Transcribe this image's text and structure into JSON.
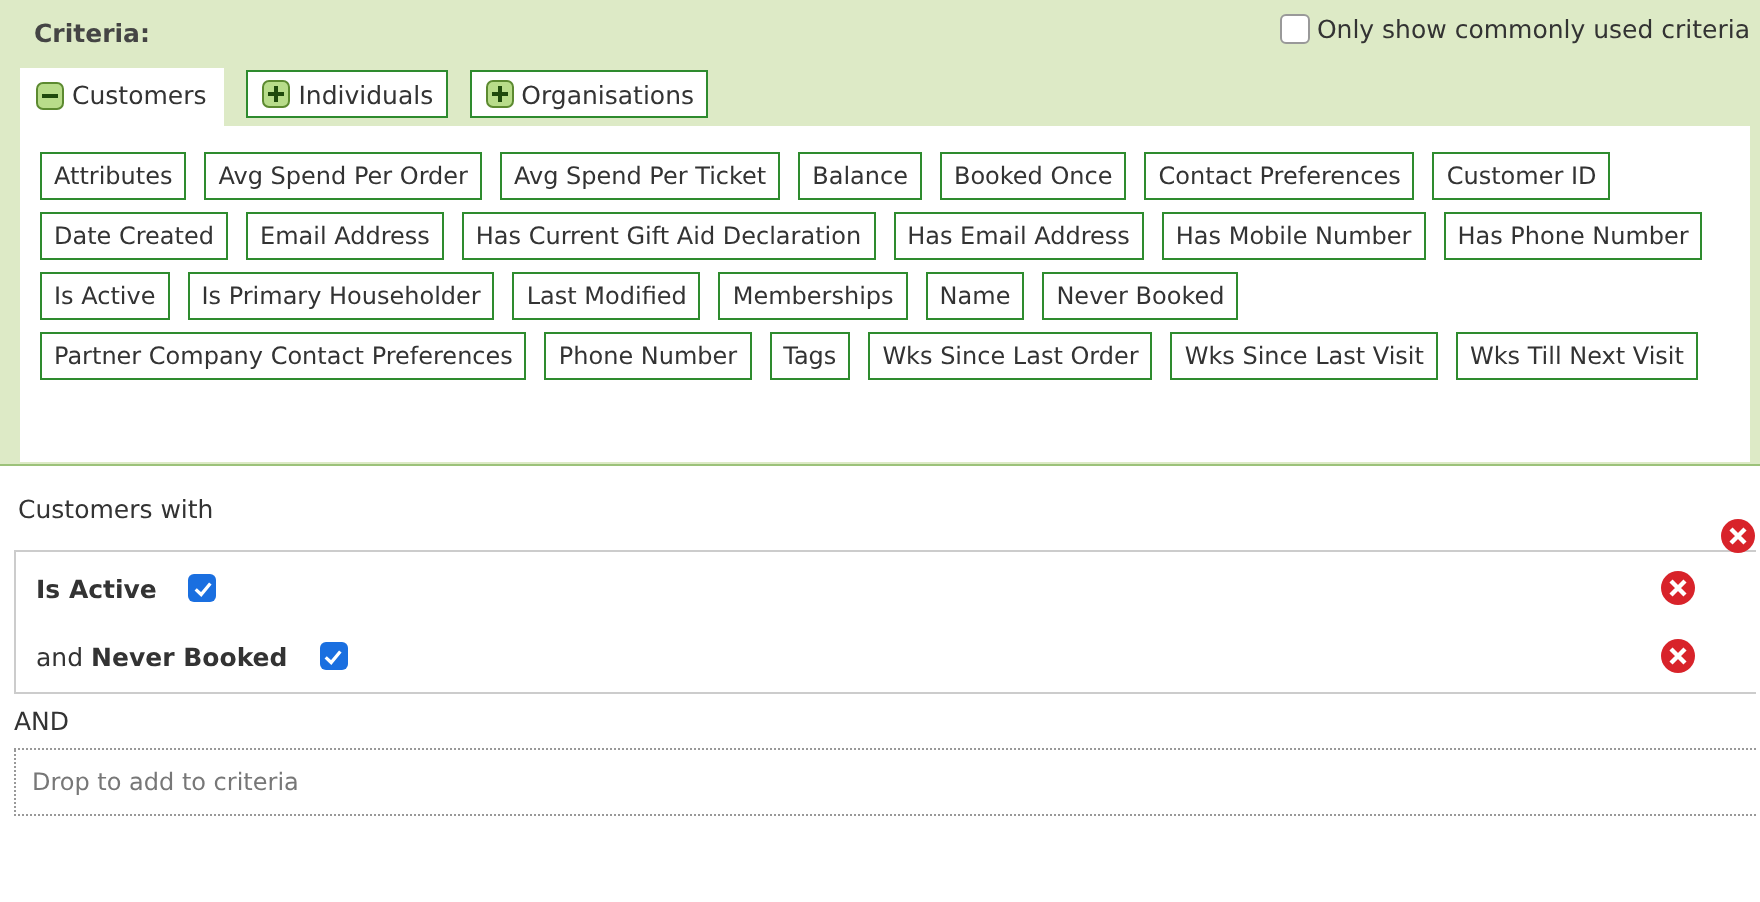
{
  "criteria": {
    "title": "Criteria:",
    "common_only": {
      "label": "Only show commonly used criteria",
      "checked": false
    }
  },
  "tabs": [
    {
      "label": "Customers",
      "selected": true
    },
    {
      "label": "Individuals",
      "selected": false
    },
    {
      "label": "Organisations",
      "selected": false
    }
  ],
  "fields": [
    "Attributes",
    "Avg Spend Per Order",
    "Avg Spend Per Ticket",
    "Balance",
    "Booked Once",
    "Contact Preferences",
    "Customer ID",
    "Date Created",
    "Email Address",
    "Has Current Gift Aid Declaration",
    "Has Email Address",
    "Has Mobile Number",
    "Has Phone Number",
    "Is Active",
    "Is Primary Householder",
    "Last Modified",
    "Memberships",
    "Name",
    "Never Booked",
    "Partner Company Contact Preferences",
    "Phone Number",
    "Tags",
    "Wks Since Last Order",
    "Wks Since Last Visit",
    "Wks Till Next Visit"
  ],
  "group": {
    "title": "Customers with",
    "conditions": [
      {
        "field": "Is Active",
        "checked": true
      },
      {
        "connector": "and",
        "field": "Never Booked",
        "checked": true
      }
    ]
  },
  "operator": "AND",
  "drop_zone": {
    "placeholder": "Drop to add to criteria"
  }
}
